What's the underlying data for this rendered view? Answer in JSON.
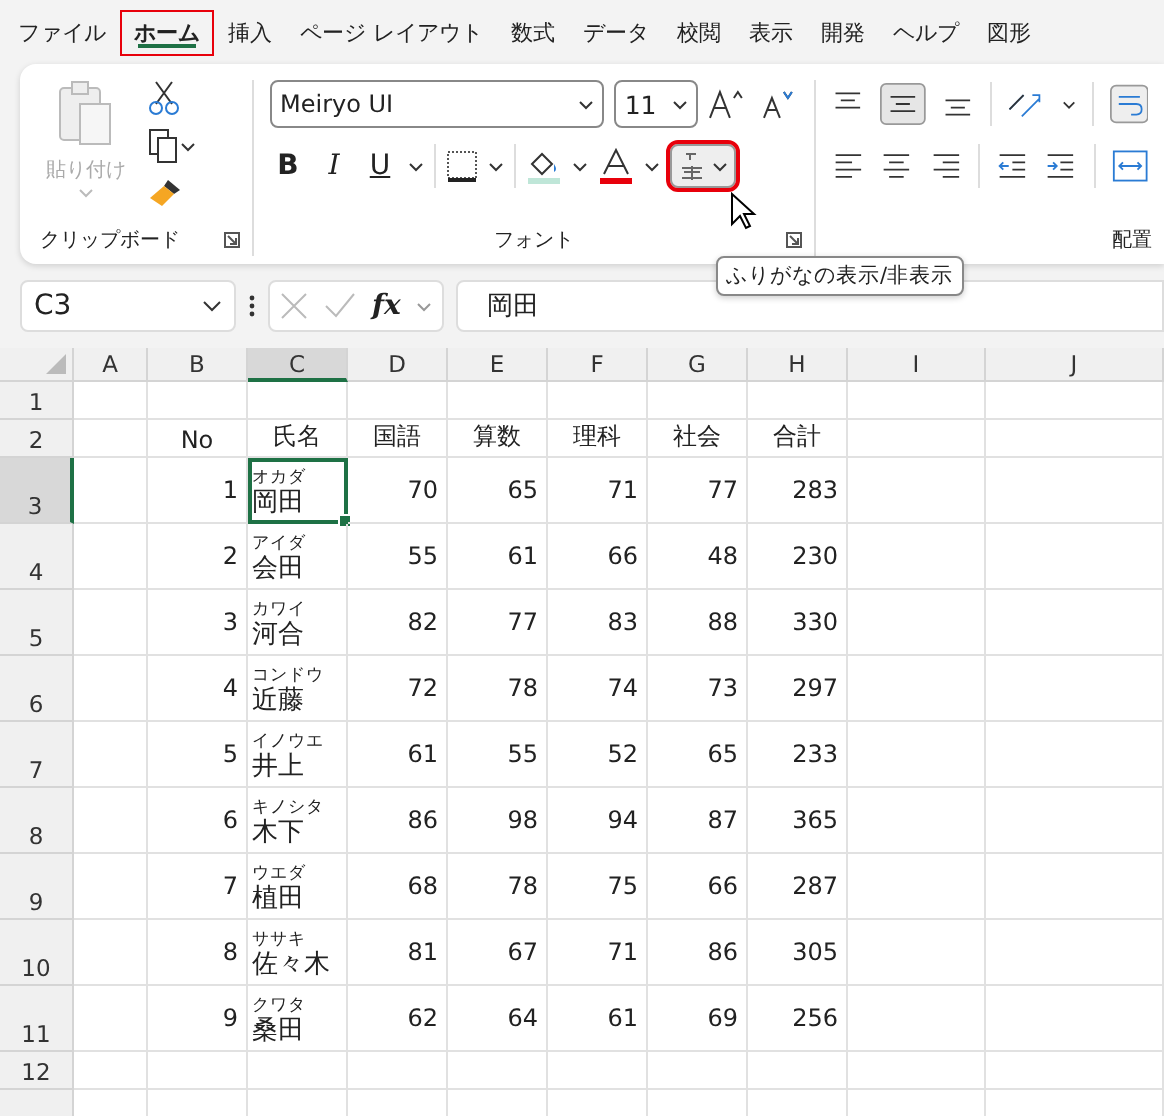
{
  "menu_tabs": [
    {
      "label": "ファイル",
      "selected": false,
      "highlighted": false
    },
    {
      "label": "ホーム",
      "selected": true,
      "highlighted": true
    },
    {
      "label": "挿入",
      "selected": false,
      "highlighted": false
    },
    {
      "label": "ページ レイアウト",
      "selected": false,
      "highlighted": false
    },
    {
      "label": "数式",
      "selected": false,
      "highlighted": false
    },
    {
      "label": "データ",
      "selected": false,
      "highlighted": false
    },
    {
      "label": "校閲",
      "selected": false,
      "highlighted": false
    },
    {
      "label": "表示",
      "selected": false,
      "highlighted": false
    },
    {
      "label": "開発",
      "selected": false,
      "highlighted": false
    },
    {
      "label": "ヘルプ",
      "selected": false,
      "highlighted": false
    },
    {
      "label": "図形",
      "selected": false,
      "highlighted": false
    }
  ],
  "ribbon": {
    "clipboard": {
      "paste_label": "貼り付け",
      "paste_disabled": true,
      "group_label": "クリップボード"
    },
    "font": {
      "font_name": "Meiryo UI",
      "font_size": "11",
      "bold": "B",
      "italic": "I",
      "underline": "U",
      "furigana_highlighted": true,
      "group_label": "フォント"
    },
    "alignment": {
      "group_label": "配置"
    }
  },
  "tooltip": "ふりがなの表示/非表示",
  "formula_bar": {
    "name_box": "C3",
    "fx": "fx",
    "value": "岡田"
  },
  "columns": [
    "A",
    "B",
    "C",
    "D",
    "E",
    "F",
    "G",
    "H",
    "I",
    "J"
  ],
  "header_row": {
    "row": "2",
    "cells": [
      "No",
      "氏名",
      "国語",
      "算数",
      "理科",
      "社会",
      "合計"
    ]
  },
  "rows": [
    {
      "row": "3",
      "no": "1",
      "furigana": "オカダ",
      "name": "岡田",
      "scores": [
        "70",
        "65",
        "71",
        "77",
        "283"
      ],
      "selected": true
    },
    {
      "row": "4",
      "no": "2",
      "furigana": "アイダ",
      "name": "会田",
      "scores": [
        "55",
        "61",
        "66",
        "48",
        "230"
      ],
      "selected": false
    },
    {
      "row": "5",
      "no": "3",
      "furigana": "カワイ",
      "name": "河合",
      "scores": [
        "82",
        "77",
        "83",
        "88",
        "330"
      ],
      "selected": false
    },
    {
      "row": "6",
      "no": "4",
      "furigana": "コンドウ",
      "name": "近藤",
      "scores": [
        "72",
        "78",
        "74",
        "73",
        "297"
      ],
      "selected": false
    },
    {
      "row": "7",
      "no": "5",
      "furigana": "イノウエ",
      "name": "井上",
      "scores": [
        "61",
        "55",
        "52",
        "65",
        "233"
      ],
      "selected": false
    },
    {
      "row": "8",
      "no": "6",
      "furigana": "キノシタ",
      "name": "木下",
      "scores": [
        "86",
        "98",
        "94",
        "87",
        "365"
      ],
      "selected": false
    },
    {
      "row": "9",
      "no": "7",
      "furigana": "ウエダ",
      "name": "植田",
      "scores": [
        "68",
        "78",
        "75",
        "66",
        "287"
      ],
      "selected": false
    },
    {
      "row": "10",
      "no": "8",
      "furigana": "ササキ",
      "name": "佐々木",
      "scores": [
        "81",
        "67",
        "71",
        "86",
        "305"
      ],
      "selected": false
    },
    {
      "row": "11",
      "no": "9",
      "furigana": "クワタ",
      "name": "桑田",
      "scores": [
        "62",
        "64",
        "61",
        "69",
        "256"
      ],
      "selected": false
    }
  ],
  "empty_rows": [
    "1",
    "12"
  ]
}
